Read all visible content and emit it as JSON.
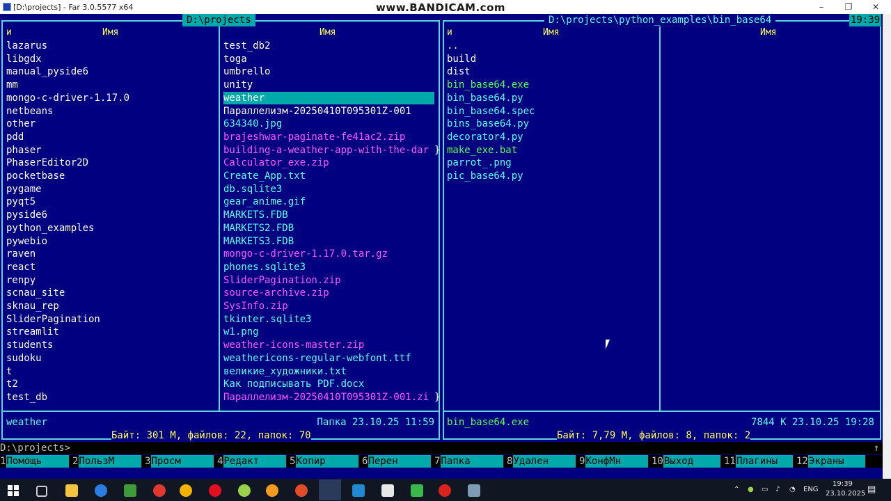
{
  "window": {
    "title": "[D:\\projects] - Far 3.0.5577 x64",
    "watermark": "www.BANDICAM.com",
    "clock": "19:39"
  },
  "left_panel": {
    "path": "D:\\projects",
    "col1_header_n": "и",
    "col1_header": "Имя",
    "col2_header": "Имя",
    "col1": [
      "lazarus",
      "libgdx",
      "manual_pyside6",
      "mm",
      "mongo-c-driver-1.17.0",
      "netbeans",
      "other",
      "pdd",
      "phaser",
      "PhaserEditor2D",
      "pocketbase",
      "pygame",
      "pyqt5",
      "pyside6",
      "python_examples",
      "pywebio",
      "raven",
      "react",
      "renpy",
      "scnau_site",
      "sknau_rep",
      "SliderPagination",
      "streamlit",
      "students",
      "sudoku",
      "t",
      "t2",
      "test_db"
    ],
    "col2": [
      {
        "name": "test_db2",
        "type": "dir"
      },
      {
        "name": "toga",
        "type": "dir"
      },
      {
        "name": "umbrello",
        "type": "dir"
      },
      {
        "name": "unity",
        "type": "dir"
      },
      {
        "name": "weather",
        "type": "selected"
      },
      {
        "name": "Параллелизм-20250410T095301Z-001",
        "type": "dir"
      },
      {
        "name": "634340.jpg",
        "type": "file"
      },
      {
        "name": "brajeshwar-paginate-fe41ac2.zip",
        "type": "archive"
      },
      {
        "name": "building-a-weather-app-with-the-dar",
        "type": "archive",
        "overflow": true
      },
      {
        "name": "Calculator_exe.zip",
        "type": "archive"
      },
      {
        "name": "Create_App.txt",
        "type": "file"
      },
      {
        "name": "db.sqlite3",
        "type": "file"
      },
      {
        "name": "gear_anime.gif",
        "type": "file"
      },
      {
        "name": "MARKETS.FDB",
        "type": "file"
      },
      {
        "name": "MARKETS2.FDB",
        "type": "file"
      },
      {
        "name": "MARKETS3.FDB",
        "type": "file"
      },
      {
        "name": "mongo-c-driver-1.17.0.tar.gz",
        "type": "archive"
      },
      {
        "name": "phones.sqlite3",
        "type": "file"
      },
      {
        "name": "SliderPagination.zip",
        "type": "archive"
      },
      {
        "name": "source-archive.zip",
        "type": "archive"
      },
      {
        "name": "SysInfo.zip",
        "type": "archive"
      },
      {
        "name": "tkinter.sqlite3",
        "type": "file"
      },
      {
        "name": "w1.png",
        "type": "file"
      },
      {
        "name": "weather-icons-master.zip",
        "type": "archive"
      },
      {
        "name": "weathericons-regular-webfont.ttf",
        "type": "file"
      },
      {
        "name": "великие_художники.txt",
        "type": "file"
      },
      {
        "name": "Как подписывать PDF.docx",
        "type": "file"
      },
      {
        "name": "Параллелизм-20250410T095301Z-001.zi",
        "type": "archive",
        "overflow": true
      }
    ],
    "status_name": "weather",
    "status_info": "Папка 23.10.25 11:59",
    "summary": " Байт: 301 М, файлов: 22, папок: 70 "
  },
  "right_panel": {
    "path": "D:\\projects\\python_examples\\bin_base64",
    "col1_header_n": "и",
    "col1_header": "Имя",
    "col2_header": "Имя",
    "col1": [
      {
        "name": "..",
        "type": "dir"
      },
      {
        "name": "build",
        "type": "dir"
      },
      {
        "name": "dist",
        "type": "dir"
      },
      {
        "name": "bin_base64.exe",
        "type": "exe"
      },
      {
        "name": "bin_base64.py",
        "type": "file"
      },
      {
        "name": "bin_base64.spec",
        "type": "file"
      },
      {
        "name": "bins_base64.py",
        "type": "file"
      },
      {
        "name": "decorator4.py",
        "type": "file"
      },
      {
        "name": "make_exe.bat",
        "type": "exe"
      },
      {
        "name": "parrot_.png",
        "type": "file"
      },
      {
        "name": "pic_base64.py",
        "type": "file"
      }
    ],
    "status_name": "bin_base64.exe",
    "status_info": "7844 К 23.10.25 19:28",
    "summary": " Байт: 7,79 М, файлов: 8, папок: 2 "
  },
  "command_line": {
    "prompt": "D:\\projects>",
    "arrow": "↑"
  },
  "keybar": [
    {
      "num": "1",
      "label": "Помощь"
    },
    {
      "num": "2",
      "label": "ПользМ"
    },
    {
      "num": "3",
      "label": "Просм"
    },
    {
      "num": "4",
      "label": "Редакт"
    },
    {
      "num": "5",
      "label": "Копир"
    },
    {
      "num": "6",
      "label": "Перен"
    },
    {
      "num": "7",
      "label": "Папка"
    },
    {
      "num": "8",
      "label": "Удален"
    },
    {
      "num": "9",
      "label": "КонфМн"
    },
    {
      "num": "10",
      "label": "Выход"
    },
    {
      "num": "11",
      "label": "Плагины"
    },
    {
      "num": "12",
      "label": "Экраны"
    }
  ],
  "taskbar": {
    "lang": "ENG",
    "time": "19:39",
    "date": "23.10.2025"
  },
  "colors": {
    "background": "#000080",
    "frame": "#5dd3dd",
    "dir": "#ffffff",
    "file": "#55ffff",
    "archive": "#ff55ff",
    "exe": "#55ff55",
    "header": "#ffff55",
    "selected_bg": "#00aaaa"
  }
}
